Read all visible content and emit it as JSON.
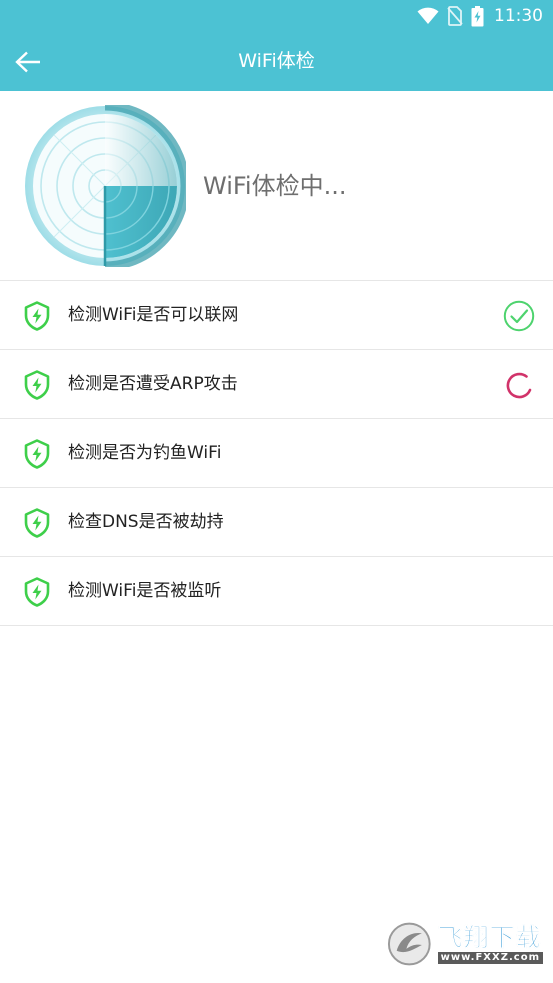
{
  "status_bar": {
    "time": "11:30",
    "icons": [
      "wifi-icon",
      "no-sim-icon",
      "battery-charging-icon"
    ]
  },
  "toolbar": {
    "back_icon": "arrow-left-icon",
    "title": "WiFi体检"
  },
  "scan": {
    "status_text": "WiFi体检中..."
  },
  "checks": [
    {
      "label": "检测WiFi是否可以联网",
      "state": "done"
    },
    {
      "label": "检测是否遭受ARP攻击",
      "state": "loading"
    },
    {
      "label": "检测是否为钓鱼WiFi",
      "state": "pending"
    },
    {
      "label": "检查DNS是否被劫持",
      "state": "pending"
    },
    {
      "label": "检测WiFi是否被监听",
      "state": "pending"
    }
  ],
  "watermark": {
    "brand": "飞翔下载",
    "url": "www.FXXZ.com"
  },
  "colors": {
    "primary": "#4cc2d3",
    "shield_green": "#3ecf4a",
    "done_green": "#4ed36e",
    "loading_pink": "#d1336a"
  }
}
